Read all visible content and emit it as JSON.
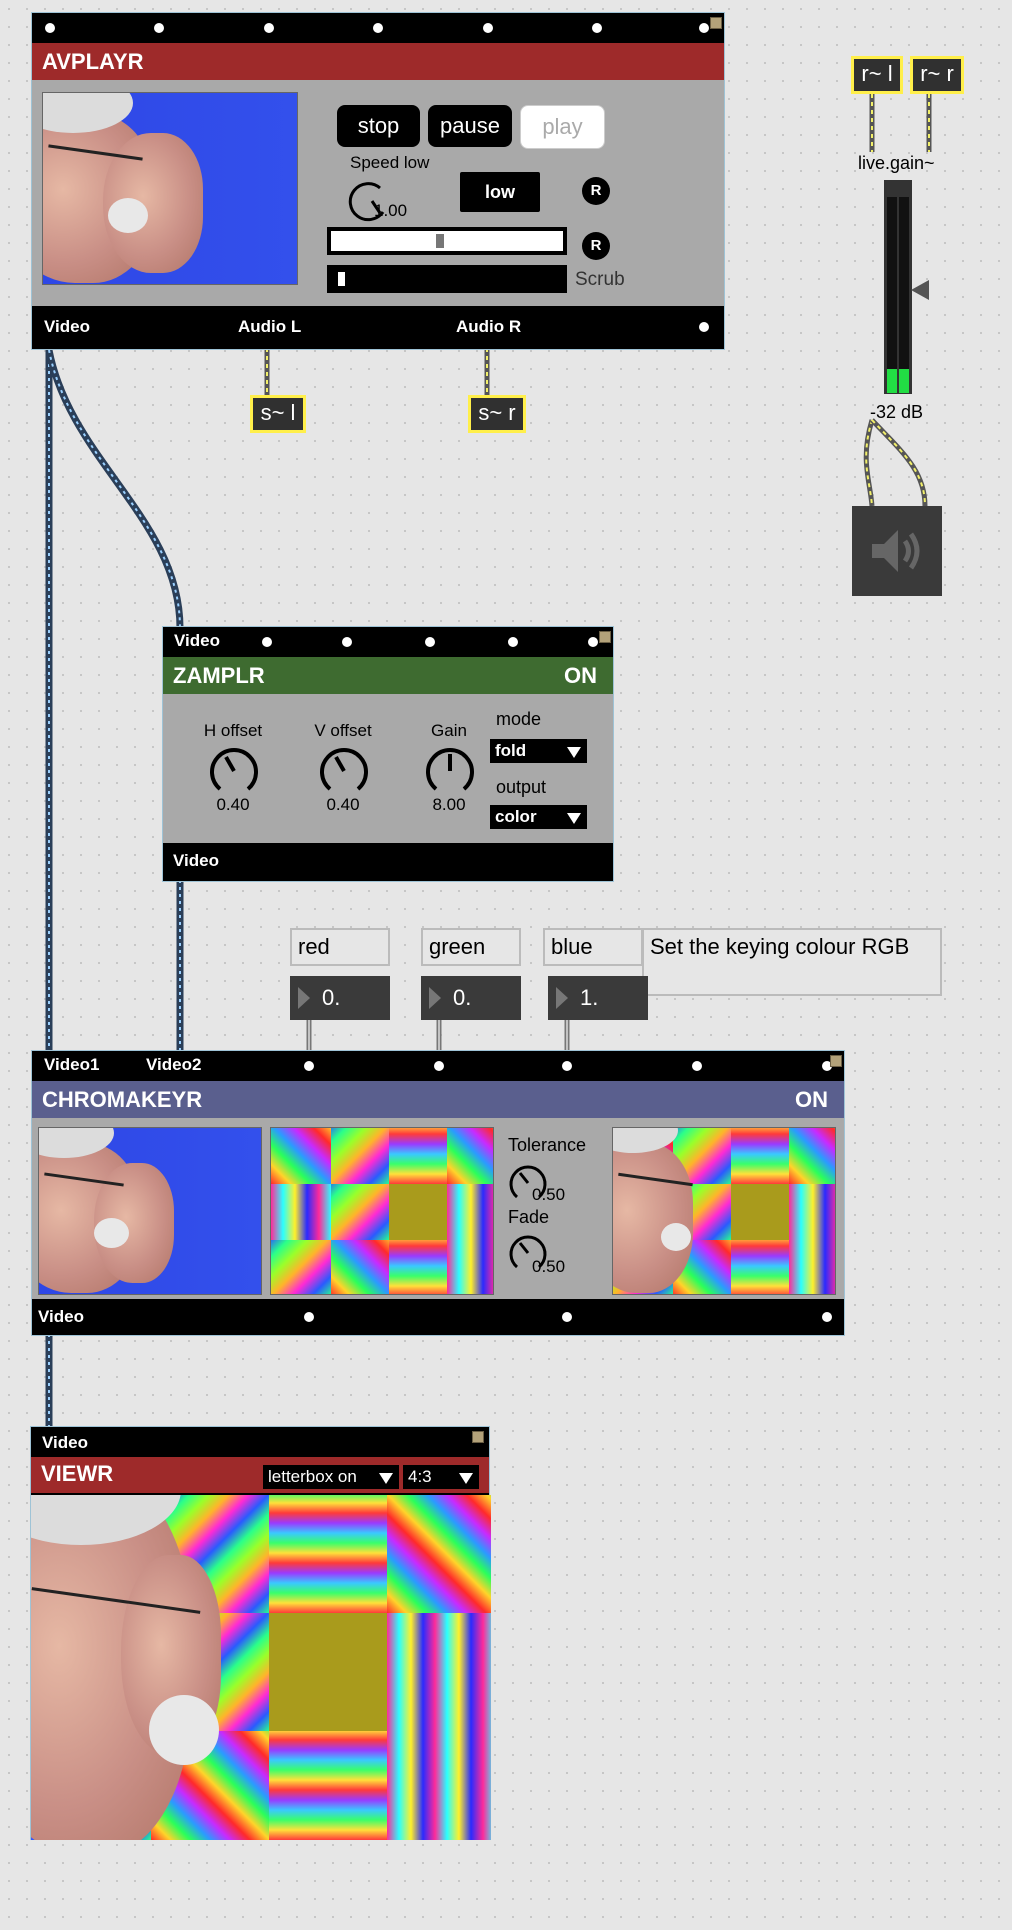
{
  "avplayr": {
    "title": "AVPLAYR",
    "title_color": "#9e2a2a",
    "buttons": {
      "stop": "stop",
      "pause": "pause",
      "play": "play"
    },
    "speed_label": "Speed low",
    "speed_value": "1.00",
    "low_button": "low",
    "reset_label": "R",
    "scrub_label": "Scrub",
    "position_slider_value": 0.47,
    "scrub_value": 0.02,
    "outlets": {
      "video": "Video",
      "audio_l": "Audio L",
      "audio_r": "Audio R"
    }
  },
  "sends": {
    "left": "s~ l",
    "right": "s~ r"
  },
  "receives": {
    "left": "r~ l",
    "right": "r~ r"
  },
  "gain": {
    "label": "live.gain~",
    "db": "-32 dB",
    "level": 0.12,
    "meter_color": "#22dd44"
  },
  "speaker": {
    "icon": "speaker-icon"
  },
  "zamplr": {
    "inlet_label": "Video",
    "title": "ZAMPLR",
    "status": "ON",
    "title_color": "#3e6b30",
    "knobs": [
      {
        "label": "H offset",
        "value": "0.40"
      },
      {
        "label": "V offset",
        "value": "0.40"
      },
      {
        "label": "Gain",
        "value": "8.00"
      }
    ],
    "mode_label": "mode",
    "mode_value": "fold",
    "output_label": "output",
    "output_value": "color",
    "outlet_label": "Video"
  },
  "keying": {
    "red_label": "red",
    "red_value": "0.",
    "green_label": "green",
    "green_value": "0.",
    "blue_label": "blue",
    "blue_value": "1.",
    "comment": "Set the keying colour RGB"
  },
  "chromakeyr": {
    "inlet1": "Video1",
    "inlet2": "Video2",
    "title": "CHROMAKEYR",
    "status": "ON",
    "title_color": "#5a5f8e",
    "tolerance_label": "Tolerance",
    "tolerance_value": "0.50",
    "fade_label": "Fade",
    "fade_value": "0.50",
    "outlet_label": "Video"
  },
  "viewr": {
    "inlet_label": "Video",
    "title": "VIEWR",
    "title_color": "#9e2a2a",
    "letterbox_value": "letterbox on",
    "aspect_value": "4:3"
  }
}
